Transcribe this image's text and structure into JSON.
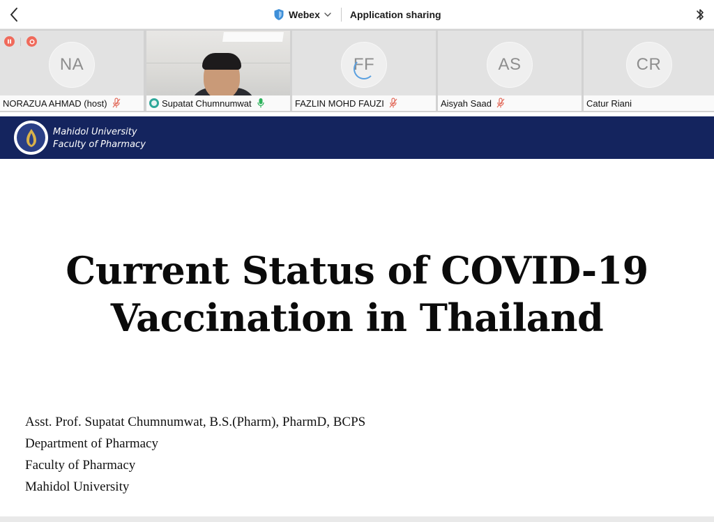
{
  "topbar": {
    "app_name": "Webex",
    "mode_label": "Application sharing"
  },
  "recording": {
    "indicators": [
      "pause-icon",
      "record-icon"
    ],
    "color": "#f06a5b"
  },
  "participants": [
    {
      "initials": "NA",
      "name": "NORAZUA AHMAD (host)",
      "mic": "muted"
    },
    {
      "initials": "",
      "name": "Supatat Chumnumwat",
      "mic": "active",
      "video": true
    },
    {
      "initials": "FF",
      "name": "FAZLIN MOHD FAUZI",
      "mic": "muted",
      "loading": true
    },
    {
      "initials": "AS",
      "name": "Aisyah Saad",
      "mic": "muted"
    },
    {
      "initials": "CR",
      "name": "Catur Riani",
      "mic": "none"
    }
  ],
  "slide": {
    "university": "Mahidol University",
    "faculty": "Faculty of Pharmacy",
    "title_line1": "Current Status of COVID-19",
    "title_line2": "Vaccination in Thailand",
    "presenter_lines": [
      "Asst. Prof. Supatat Chumnumwat, B.S.(Pharm), PharmD, BCPS",
      "Department of Pharmacy",
      "Faculty of Pharmacy",
      "Mahidol University"
    ]
  },
  "colors": {
    "header_navy": "#14245e",
    "mic_muted": "#e26a5a",
    "mic_active": "#2db35c",
    "shield_blue": "#3e8fd8"
  }
}
